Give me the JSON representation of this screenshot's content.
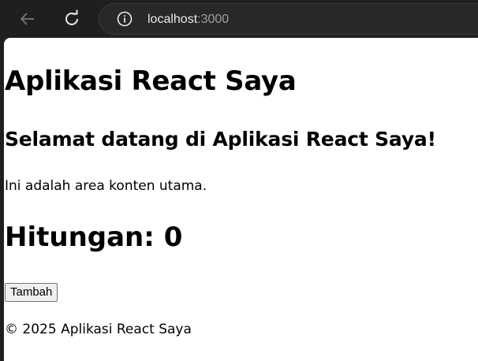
{
  "browser": {
    "url_host": "localhost",
    "url_port": ":3000",
    "icons": {
      "back": "back-arrow-icon",
      "reload": "reload-icon",
      "info": "info-icon"
    }
  },
  "page": {
    "title": "Aplikasi React Saya",
    "welcome": "Selamat datang di Aplikasi React Saya!",
    "content_text": "Ini adalah area konten utama.",
    "counter_label": "Hitungan: 0",
    "add_button_label": "Tambah",
    "footer": "© 2025 Aplikasi React Saya"
  }
}
